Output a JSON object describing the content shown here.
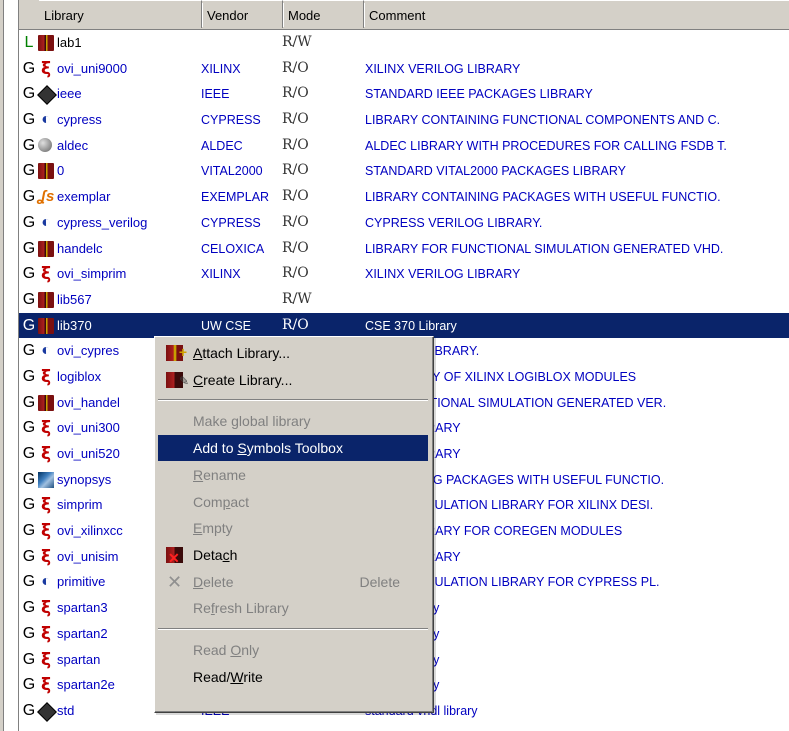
{
  "columns": {
    "library": "Library",
    "vendor": "Vendor",
    "mode": "Mode",
    "comment": "Comment"
  },
  "rows": [
    {
      "type": "L",
      "icon": "book-icon",
      "name": "lab1",
      "vendor": "",
      "mode": "R/W",
      "comment": ""
    },
    {
      "type": "G",
      "icon": "xilinx-icon",
      "name": "ovi_uni9000",
      "vendor": "XILINX",
      "mode": "R/O",
      "comment": "XILINX VERILOG LIBRARY"
    },
    {
      "type": "G",
      "icon": "ieee-diamond-icon",
      "name": "ieee",
      "vendor": "IEEE",
      "mode": "R/O",
      "comment": "STANDARD IEEE PACKAGES LIBRARY"
    },
    {
      "type": "G",
      "icon": "cypress-icon",
      "name": "cypress",
      "vendor": "CYPRESS",
      "mode": "R/O",
      "comment": "LIBRARY CONTAINING FUNCTIONAL COMPONENTS AND C."
    },
    {
      "type": "G",
      "icon": "aldec-icon",
      "name": "aldec",
      "vendor": "ALDEC",
      "mode": "R/O",
      "comment": "ALDEC LIBRARY WITH PROCEDURES FOR CALLING FSDB T."
    },
    {
      "type": "G",
      "icon": "book-icon",
      "name": "0",
      "vendor": "VITAL2000",
      "mode": "R/O",
      "comment": "STANDARD VITAL2000 PACKAGES LIBRARY"
    },
    {
      "type": "G",
      "icon": "exemplar-icon",
      "name": "exemplar",
      "vendor": "EXEMPLAR",
      "mode": "R/O",
      "comment": "LIBRARY CONTAINING PACKAGES WITH USEFUL FUNCTIO."
    },
    {
      "type": "G",
      "icon": "cypress-icon",
      "name": "cypress_verilog",
      "vendor": "CYPRESS",
      "mode": "R/O",
      "comment": "CYPRESS VERILOG LIBRARY."
    },
    {
      "type": "G",
      "icon": "book-icon",
      "name": "handelc",
      "vendor": "CELOXICA",
      "mode": "R/O",
      "comment": "LIBRARY FOR FUNCTIONAL SIMULATION GENERATED VHD."
    },
    {
      "type": "G",
      "icon": "xilinx-icon",
      "name": "ovi_simprim",
      "vendor": "XILINX",
      "mode": "R/O",
      "comment": "XILINX VERILOG LIBRARY"
    },
    {
      "type": "G",
      "icon": "book-icon",
      "name": "lib567",
      "vendor": "",
      "mode": "R/W",
      "comment": ""
    },
    {
      "type": "G",
      "icon": "book-icon",
      "name": "lib370",
      "vendor": "UW CSE",
      "mode": "R/O",
      "comment": "CSE 370 Library",
      "selected": true
    },
    {
      "type": "G",
      "icon": "cypress-icon",
      "name": "ovi_cypres",
      "vendor": "",
      "mode": "",
      "comment": "VERILOG LIBRARY."
    },
    {
      "type": "G",
      "icon": "xilinx-icon",
      "name": "logiblox",
      "vendor": "",
      "mode": "",
      "comment": "ON LIBRARY OF XILINX LOGIBLOX MODULES"
    },
    {
      "type": "G",
      "icon": "book-icon",
      "name": "ovi_handel",
      "vendor": "",
      "mode": "",
      "comment": "FOR FUNCTIONAL SIMULATION GENERATED VER."
    },
    {
      "type": "G",
      "icon": "xilinx-icon",
      "name": "ovi_uni300",
      "vendor": "",
      "mode": "",
      "comment": "RILOG LIBRARY"
    },
    {
      "type": "G",
      "icon": "xilinx-icon",
      "name": "ovi_uni520",
      "vendor": "",
      "mode": "",
      "comment": "RILOG LIBRARY"
    },
    {
      "type": "G",
      "icon": "synopsys-icon",
      "name": "synopsys",
      "vendor": "",
      "mode": "",
      "comment": "CONTAINING PACKAGES WITH USEFUL FUNCTIO."
    },
    {
      "type": "G",
      "icon": "xilinx-icon",
      "name": "simprim",
      "vendor": "",
      "mode": "",
      "comment": "TIMING SIMULATION LIBRARY FOR XILINX DESI."
    },
    {
      "type": "G",
      "icon": "xilinx-icon",
      "name": "ovi_xilinxcc",
      "vendor": "",
      "mode": "",
      "comment": "RILOG LIBRARY FOR COREGEN MODULES"
    },
    {
      "type": "G",
      "icon": "xilinx-icon",
      "name": "ovi_unisim",
      "vendor": "",
      "mode": "",
      "comment": "RILOG LIBRARY"
    },
    {
      "type": "G",
      "icon": "cypress-icon",
      "name": "primitive",
      "vendor": "",
      "mode": "",
      "comment": "TIMING SIMULATION LIBRARY FOR CYPRESS PL."
    },
    {
      "type": "G",
      "icon": "xilinx-icon",
      "name": "spartan3",
      "vendor": "",
      "mode": "",
      "comment": "ematic library"
    },
    {
      "type": "G",
      "icon": "xilinx-icon",
      "name": "spartan2",
      "vendor": "",
      "mode": "",
      "comment": "ematic library"
    },
    {
      "type": "G",
      "icon": "xilinx-icon",
      "name": "spartan",
      "vendor": "",
      "mode": "",
      "comment": "ematic library"
    },
    {
      "type": "G",
      "icon": "xilinx-icon",
      "name": "spartan2e",
      "vendor": "",
      "mode": "",
      "comment": "ematic library"
    },
    {
      "type": "G",
      "icon": "ieee-diamond-icon",
      "name": "std",
      "vendor": "IEEE",
      "mode": "",
      "comment": "standard vhdl library"
    }
  ],
  "context_menu": {
    "items": [
      {
        "id": "attach",
        "pre": "",
        "u": "A",
        "post": "ttach Library...",
        "icon": "attach-library-icon",
        "disabled": false
      },
      {
        "id": "create",
        "pre": "",
        "u": "C",
        "post": "reate Library...",
        "icon": "create-library-icon",
        "disabled": false
      },
      {
        "sep": true
      },
      {
        "id": "make-global",
        "pre": "Make ",
        "u": "g",
        "post": "lobal library",
        "disabled": true
      },
      {
        "id": "add-symbols",
        "pre": "Add to ",
        "u": "S",
        "post": "ymbols Toolbox",
        "disabled": false,
        "highlighted": true
      },
      {
        "id": "rename",
        "pre": "",
        "u": "R",
        "post": "ename",
        "disabled": true
      },
      {
        "id": "compact",
        "pre": "Com",
        "u": "p",
        "post": "act",
        "disabled": true
      },
      {
        "id": "empty",
        "pre": "",
        "u": "E",
        "post": "mpty",
        "disabled": true
      },
      {
        "id": "detach",
        "pre": "Deta",
        "u": "c",
        "post": "h",
        "icon": "detach-icon",
        "disabled": false
      },
      {
        "id": "delete",
        "pre": "",
        "u": "D",
        "post": "elete",
        "icon": "delete-icon",
        "shortcut": "Delete",
        "disabled": true
      },
      {
        "id": "refresh",
        "pre": "Re",
        "u": "f",
        "post": "resh Library",
        "disabled": true
      },
      {
        "sep": true
      },
      {
        "id": "read-only",
        "pre": "Read ",
        "u": "O",
        "post": "nly",
        "disabled": true
      },
      {
        "id": "read-write",
        "pre": "Read/",
        "u": "W",
        "post": "rite",
        "disabled": false
      }
    ]
  },
  "colors": {
    "selection": "#0a246a",
    "link_text": "#0000c0",
    "menu_bg": "#d4d0c8"
  }
}
